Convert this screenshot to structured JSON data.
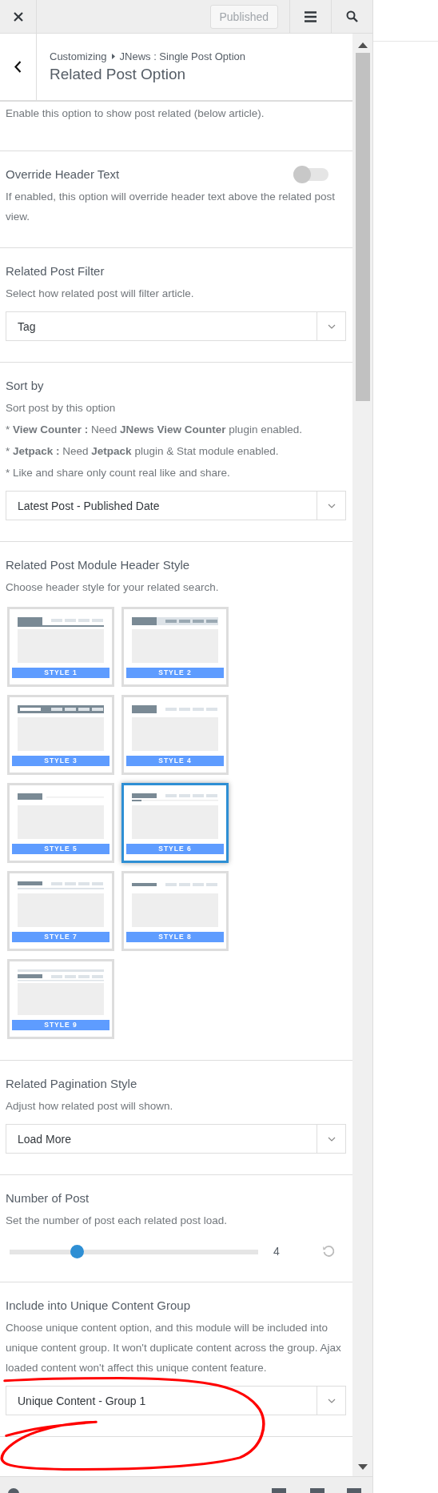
{
  "topbar": {
    "published_button": {
      "label": "Published",
      "disabled": true
    }
  },
  "header": {
    "breadcrumb": [
      "Customizing",
      "JNews : Single Post Option"
    ],
    "title": "Related Post Option"
  },
  "intro": "Enable this option to show post related (below article).",
  "sections": [
    {
      "kind": "toggle",
      "title": "Override Header Text",
      "description": [
        "If enabled, this option will override header text above the related post view."
      ],
      "on": false
    },
    {
      "kind": "select",
      "title": "Related Post Filter",
      "description": [
        "Select how related post will filter article."
      ],
      "value": "Tag"
    },
    {
      "kind": "select",
      "title": "Sort by",
      "description": [
        "Sort post by this option",
        "* **View Counter :** Need **JNews View Counter** plugin enabled.",
        "* **Jetpack :** Need **Jetpack** plugin & Stat module enabled.",
        "* Like and share only count real like and share."
      ],
      "value": "Latest Post - Published Date"
    },
    {
      "kind": "styles",
      "title": "Related Post Module Header Style",
      "description": [
        "Choose header style for your related search."
      ],
      "options": [
        {
          "label": "STYLE 1",
          "selected": false
        },
        {
          "label": "STYLE 2",
          "selected": false
        },
        {
          "label": "STYLE 3",
          "selected": false
        },
        {
          "label": "STYLE 4",
          "selected": false
        },
        {
          "label": "STYLE 5",
          "selected": false
        },
        {
          "label": "STYLE 6",
          "selected": true
        },
        {
          "label": "STYLE 7",
          "selected": false
        },
        {
          "label": "STYLE 8",
          "selected": false
        },
        {
          "label": "STYLE 9",
          "selected": false
        }
      ]
    },
    {
      "kind": "select",
      "title": "Related Pagination Style",
      "description": [
        "Adjust how related post will shown."
      ],
      "value": "Load More"
    },
    {
      "kind": "slider",
      "title": "Number of Post",
      "description": [
        "Set the number of post each related post load."
      ],
      "level": 0.25,
      "reading": "4"
    },
    {
      "kind": "select",
      "title": "Include into Unique Content Group",
      "description": [
        "Choose unique content option, and this module will be included into unique content group. It won't duplicate content across the group. Ajax loaded content won't affect this unique content feature."
      ],
      "value": "Unique Content - Group 1"
    }
  ]
}
